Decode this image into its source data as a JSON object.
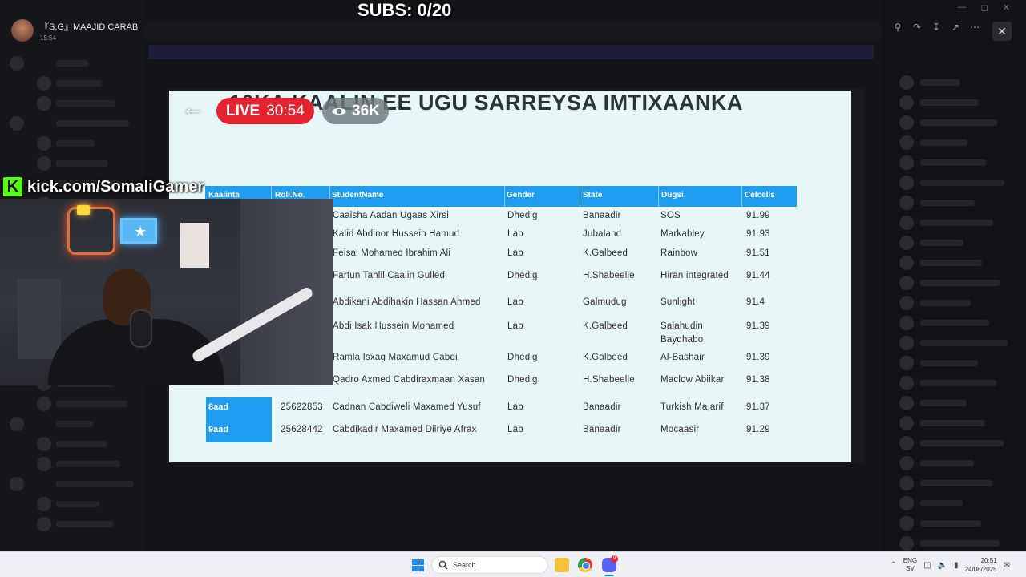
{
  "stream": {
    "profile_name": "『S.G』MAAJID CARAB",
    "profile_time": "15:54",
    "subs_counter": "SUBS: 0/20",
    "live_label": "LIVE",
    "live_duration": "30:54",
    "viewer_count": "36K",
    "kick_url": "kick.com/SomaliGamer",
    "kick_logo_letter": "K"
  },
  "slide": {
    "title": "10KA KAALIN EE UGU SARREYSA IMTIXAANKA",
    "headers": {
      "rank": "Kaalinta",
      "roll": "Roll.No.",
      "name": "StudentName",
      "gender": "Gender",
      "state": "State",
      "dugsi": "Dugsi",
      "score": "Celcelis"
    },
    "rows": [
      {
        "rank": "",
        "roll": "",
        "name": "Caaisha Aadan Ugaas Xirsi",
        "gender": "Dhedig",
        "state": "Banaadir",
        "dugsi": "SOS",
        "dugsi2": "",
        "score": "91.99"
      },
      {
        "rank": "",
        "roll": "",
        "name": "Kalid Abdinor Hussein Hamud",
        "gender": "Lab",
        "state": "Jubaland",
        "dugsi": "Markabley",
        "dugsi2": "",
        "score": "91.93"
      },
      {
        "rank": "",
        "roll": "",
        "name": "Feisal Mohamed Ibrahim Ali",
        "gender": "Lab",
        "state": "K.Galbeed",
        "dugsi": "Rainbow",
        "dugsi2": "",
        "score": "91.51"
      },
      {
        "rank": "",
        "roll": "",
        "name": "Fartun Tahlil Caalin Gulled",
        "gender": "Dhedig",
        "state": "H.Shabeelle",
        "dugsi": "Hiran integrated",
        "dugsi2": "",
        "score": "91.44"
      },
      {
        "rank": "",
        "roll": "",
        "name": "Abdikani Abdihakin Hassan Ahmed",
        "gender": "Lab",
        "state": "Galmudug",
        "dugsi": "Sunlight",
        "dugsi2": "",
        "score": "91.4"
      },
      {
        "rank": "",
        "roll": "",
        "name": "Abdi Isak Hussein Mohamed",
        "gender": "Lab",
        "state": "K.Galbeed",
        "dugsi": "Salahudin",
        "dugsi2": "Baydhabo",
        "score": "91.39"
      },
      {
        "rank": "",
        "roll": "",
        "name": "Ramla Isxag Maxamud Cabdi",
        "gender": "Dhedig",
        "state": "K.Galbeed",
        "dugsi": "Al-Bashair",
        "dugsi2": "",
        "score": "91.39"
      },
      {
        "rank": "",
        "roll": "",
        "name": "Qadro Axmed Cabdiraxmaan Xasan",
        "gender": "Dhedig",
        "state": "H.Shabeelle",
        "dugsi": "Maclow Abiikar",
        "dugsi2": "",
        "score": "91.38"
      },
      {
        "rank": "8aad",
        "roll": "25622853",
        "name": "Cadnan Cabdiweli Maxamed Yusuf",
        "gender": "Lab",
        "state": "Banaadir",
        "dugsi": "Turkish Ma,arif",
        "dugsi2": "",
        "score": "91.37"
      },
      {
        "rank": "9aad",
        "roll": "25628442",
        "name": "Cabdikadir Maxamed Diiriye Afrax",
        "gender": "Lab",
        "state": "Banaadir",
        "dugsi": "Mocaasir",
        "dugsi2": "",
        "score": "91.29"
      }
    ]
  },
  "taskbar": {
    "search_label": "Search",
    "lang_top": "ENG",
    "lang_bottom": "SV",
    "time": "20:51",
    "date": "24/08/2025",
    "discord_badge": "9"
  },
  "colors": {
    "live_red": "#e5232e",
    "table_blue": "#1f9df1",
    "kick_green": "#53fc18"
  }
}
